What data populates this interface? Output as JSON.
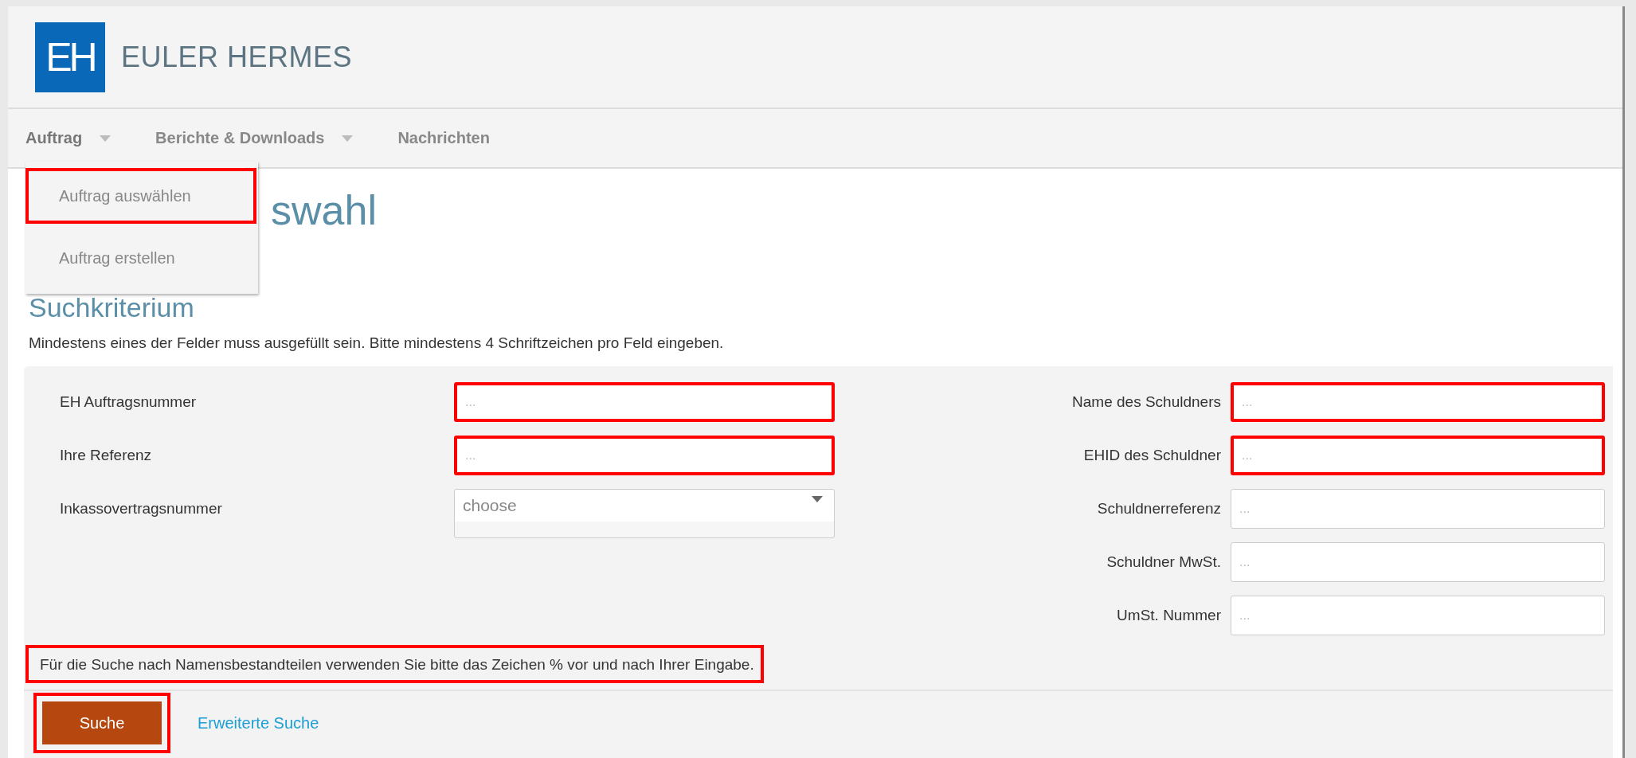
{
  "logo": {
    "mark": "EH",
    "name": "EULER HERMES"
  },
  "nav": {
    "items": [
      {
        "label": "Auftrag",
        "has_menu": true,
        "open": true
      },
      {
        "label": "Berichte & Downloads",
        "has_menu": true,
        "open": false
      },
      {
        "label": "Nachrichten",
        "has_menu": false,
        "open": false
      }
    ],
    "menu": [
      {
        "label": "Auftrag auswählen",
        "highlighted": true
      },
      {
        "label": "Auftrag erstellen",
        "highlighted": false
      }
    ]
  },
  "heading": "swahl",
  "subheading": "Suchkriterium",
  "description": "Mindestens eines der Felder muss ausgefüllt sein. Bitte mindestens 4 Schriftzeichen pro Feld eingeben.",
  "left_fields": [
    {
      "label": "EH Auftragsnummer",
      "kind": "text",
      "placeholder": "...",
      "highlighted": true
    },
    {
      "label": "Ihre Referenz",
      "kind": "text",
      "placeholder": "...",
      "highlighted": true
    },
    {
      "label": "Inkassovertragsnummer",
      "kind": "select",
      "value": "choose",
      "highlighted": false
    }
  ],
  "right_fields": [
    {
      "label": "Name des Schuldners",
      "kind": "text",
      "placeholder": "...",
      "highlighted": true
    },
    {
      "label": "EHID des Schuldner",
      "kind": "text",
      "placeholder": "...",
      "highlighted": true
    },
    {
      "label": "Schuldnerreferenz",
      "kind": "text",
      "placeholder": "...",
      "highlighted": false
    },
    {
      "label": "Schuldner MwSt.",
      "kind": "text",
      "placeholder": "...",
      "highlighted": false
    },
    {
      "label": "UmSt. Nummer",
      "kind": "text",
      "placeholder": "...",
      "highlighted": false
    }
  ],
  "note": {
    "text": "Für die Suche nach Namensbestandteilen verwenden Sie bitte das Zeichen % vor und nach Ihrer Eingabe.",
    "highlighted": true
  },
  "search_button": {
    "label": "Suche",
    "highlighted": true
  },
  "advanced_link": "Erweiterte Suche"
}
